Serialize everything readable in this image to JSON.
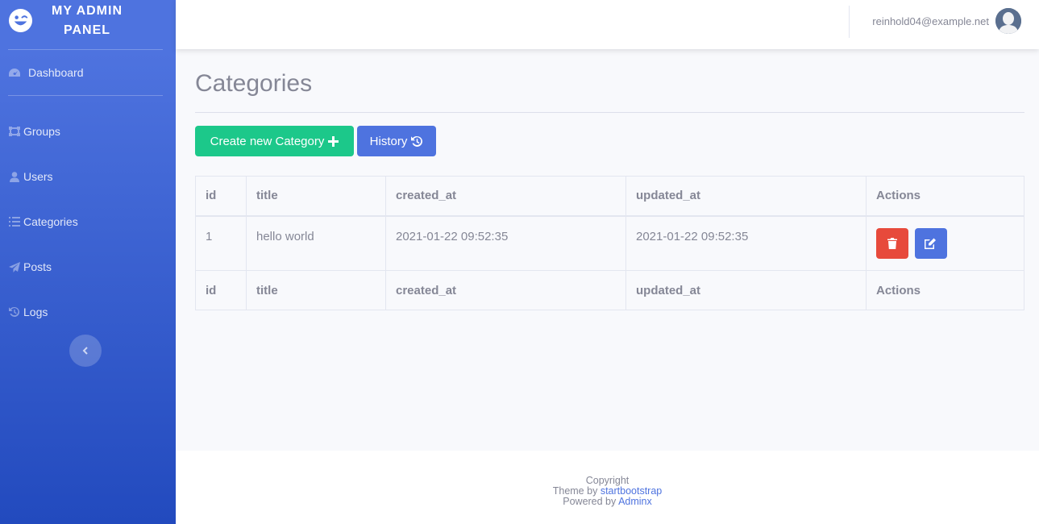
{
  "sidebar": {
    "brand": "MY ADMIN PANEL",
    "items": [
      {
        "label": "Dashboard",
        "icon": "dashboard-icon"
      },
      {
        "label": "Groups",
        "icon": "groups-icon"
      },
      {
        "label": "Users",
        "icon": "user-icon"
      },
      {
        "label": "Categories",
        "icon": "list-icon"
      },
      {
        "label": "Posts",
        "icon": "paper-plane-icon"
      },
      {
        "label": "Logs",
        "icon": "history-icon"
      }
    ],
    "toggle_icon": "chevron-left-icon"
  },
  "topbar": {
    "user_email": "reinhold04@example.net",
    "avatar_icon": "user-avatar-icon"
  },
  "main": {
    "title": "Categories",
    "create_button": "Create new Category",
    "history_button": "History",
    "table": {
      "columns": [
        "id",
        "title",
        "created_at",
        "updated_at",
        "Actions"
      ],
      "rows": [
        {
          "id": "1",
          "title": "hello world",
          "created_at": "2021-01-22 09:52:35",
          "updated_at": "2021-01-22 09:52:35"
        }
      ]
    }
  },
  "footer": {
    "copyright": "Copyright",
    "theme_prefix": "Theme by",
    "theme_link": "startbootstrap",
    "powered_prefix": "Powered by",
    "powered_link": "Adminx"
  },
  "colors": {
    "sidebar_top": "#4e73df",
    "sidebar_bottom": "#224abe",
    "success": "#1cc88a",
    "primary": "#4e73df",
    "danger": "#e74a3b"
  }
}
